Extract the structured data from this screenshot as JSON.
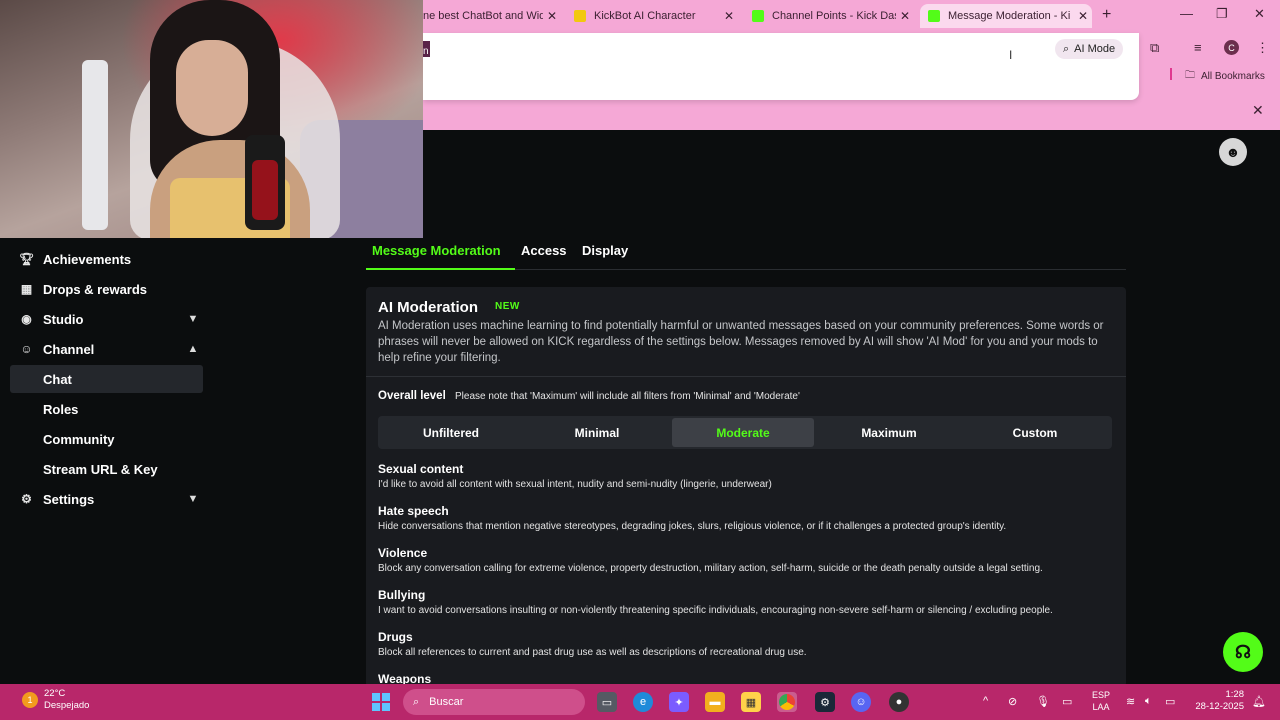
{
  "browser": {
    "tabs": [
      {
        "title": "ne best ChatBot and Widg",
        "favicon_color": "#f5a8d6"
      },
      {
        "title": "KickBot AI Character",
        "favicon_color": "#f2c80f"
      },
      {
        "title": "Channel Points - Kick Dash",
        "favicon_color": "#53fc18"
      },
      {
        "title": "Message Moderation - Kick",
        "favicon_color": "#53fc18",
        "active": true
      }
    ],
    "omnibox_prefix": "n",
    "ai_mode_label": "AI Mode",
    "profile_initial": "C",
    "bookmarks_label": "All Bookmarks"
  },
  "sidebar": {
    "items": [
      {
        "label": "Achievements",
        "icon": "trophy-icon"
      },
      {
        "label": "Drops & rewards",
        "icon": "gift-icon"
      },
      {
        "label": "Studio",
        "icon": "studio-icon",
        "expandable": true,
        "expanded": false
      },
      {
        "label": "Channel",
        "icon": "users-icon",
        "expandable": true,
        "expanded": true
      },
      {
        "label": "Chat",
        "sub": true,
        "selected": true
      },
      {
        "label": "Roles",
        "sub": true
      },
      {
        "label": "Community",
        "sub": true
      },
      {
        "label": "Stream URL & Key",
        "sub": true
      },
      {
        "label": "Settings",
        "icon": "gear-icon",
        "expandable": true,
        "expanded": false
      }
    ]
  },
  "subtabs": [
    "Message Moderation",
    "Access",
    "Display"
  ],
  "active_subtab": "Message Moderation",
  "ai_moderation": {
    "title": "AI Moderation",
    "badge": "NEW",
    "description": "AI Moderation uses machine learning to find potentially harmful or unwanted messages based on your community preferences. Some words or phrases will never be allowed on KICK regardless of the settings below. Messages removed by AI will show 'AI Mod' for you and your mods to help refine your filtering.",
    "overall_label": "Overall level",
    "overall_note": "Please note that 'Maximum' will include all filters from 'Minimal' and 'Moderate'",
    "levels": [
      "Unfiltered",
      "Minimal",
      "Moderate",
      "Maximum",
      "Custom"
    ],
    "selected_level": "Moderate",
    "categories": [
      {
        "title": "Sexual content",
        "desc": "I'd like to avoid all content with sexual intent, nudity and semi-nudity (lingerie, underwear)"
      },
      {
        "title": "Hate speech",
        "desc": "Hide conversations that mention negative stereotypes, degrading jokes, slurs, religious violence, or if it challenges a protected group's identity."
      },
      {
        "title": "Violence",
        "desc": "Block any conversation calling for extreme violence, property destruction, military action, self-harm, suicide or the death penalty outside a legal setting."
      },
      {
        "title": "Bullying",
        "desc": "I want to avoid conversations insulting or non-violently threatening specific individuals, encouraging non-severe self-harm or silencing / excluding people."
      },
      {
        "title": "Drugs",
        "desc": "Block all references to current and past drug use as well as descriptions of recreational drug use."
      },
      {
        "title": "Weapons",
        "desc": ""
      }
    ]
  },
  "taskbar": {
    "weather_temp": "22°C",
    "weather_desc": "Despejado",
    "weather_badge": "1",
    "search_placeholder": "Buscar",
    "lang_top": "ESP",
    "lang_bottom": "LAA",
    "time": "1:28",
    "date": "28-12-2025"
  },
  "colors": {
    "accent": "#53fc18",
    "chrome": "#f5a8d6",
    "taskbar": "#b8276a",
    "panel": "#191b1f"
  }
}
